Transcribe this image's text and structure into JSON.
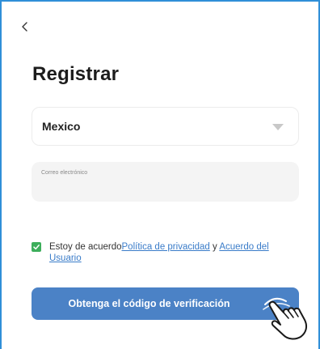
{
  "header": {
    "back_icon": "chevron-left-icon"
  },
  "page": {
    "title": "Registrar"
  },
  "country": {
    "value": "Mexico",
    "icon": "triangle-down-icon"
  },
  "email": {
    "label": "Correo electrónico",
    "value": ""
  },
  "agreement": {
    "checked": true,
    "prefix": "Estoy de acuerdo",
    "privacy_link": "Política de privacidad",
    "and": " y ",
    "terms_link": "Acuerdo del Usuario"
  },
  "action": {
    "submit_label": "Obtenga el código de verificación",
    "pointer_icon": "hand-pointer-icon"
  },
  "colors": {
    "accent": "#4b82c6",
    "link": "#3a7cc9",
    "checkbox": "#3dae5b",
    "frame": "#2f8fd8"
  }
}
